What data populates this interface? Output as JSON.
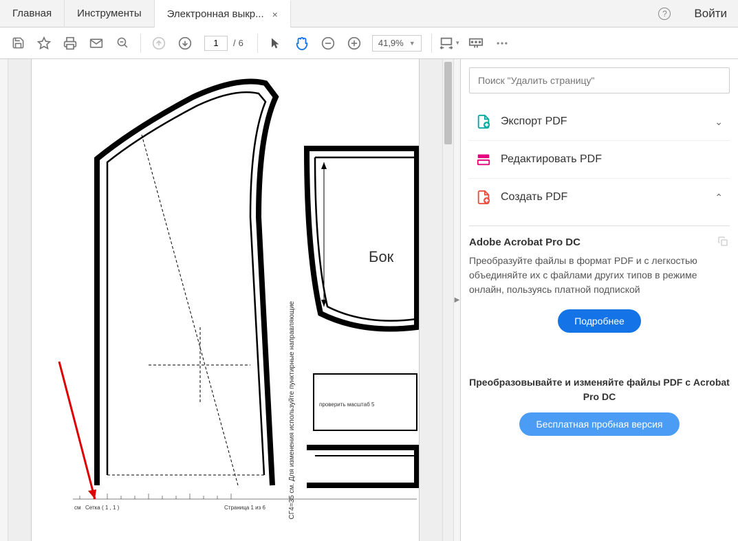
{
  "tabs": {
    "home": "Главная",
    "tools": "Инструменты",
    "doc": "Электронная выкр...",
    "close": "×"
  },
  "header": {
    "signin": "Войти",
    "help": "?"
  },
  "toolbar": {
    "page_current": "1",
    "page_sep": "/",
    "page_total": "6",
    "zoom": "41,9%"
  },
  "doc": {
    "bok_label": "Бок",
    "vertical_note": "СГ4=35 см. Для изменения используйте пунктирные направляющие",
    "scale_check": "проверить масштаб 5",
    "footer_page": "Страница 1 из 6",
    "ruler_unit": "см",
    "grid_label": "Сетка ( 1 , 1 )"
  },
  "sidebar": {
    "search_placeholder": "Поиск \"Удалить страницу\"",
    "tools": {
      "export": "Экспорт PDF",
      "edit": "Редактировать PDF",
      "create": "Создать PDF"
    },
    "promo": {
      "title": "Adobe Acrobat Pro DC",
      "text": "Преобразуйте файлы в формат PDF и с легкостью объединяйте их с файлами других типов в режиме онлайн, пользуясь платной подпиской",
      "button": "Подробнее"
    },
    "promo2": {
      "title": "Преобразовывайте и изменяйте файлы PDF с Acrobat Pro DC",
      "button": "Бесплатная пробная версия"
    }
  }
}
